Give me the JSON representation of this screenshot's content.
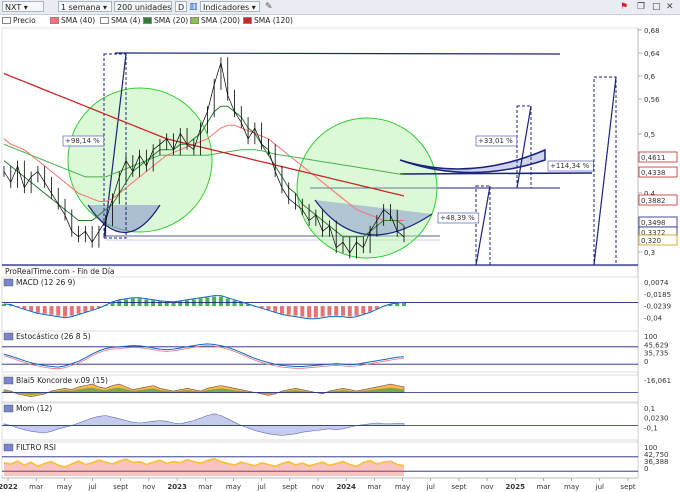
{
  "toolbar": {
    "symbol": "NXT",
    "period": "1 semana",
    "units": "200 unidades",
    "mode": "D",
    "indicators": "Indicadores"
  },
  "legend": [
    {
      "label": "Precio",
      "color": "#ffffff"
    },
    {
      "label": "SMA (40)",
      "color": "#ff6f6f"
    },
    {
      "label": "SMA (4)",
      "color": "#ffffff"
    },
    {
      "label": "SMA (20)",
      "color": "#2e7d32"
    },
    {
      "label": "SMA (200)",
      "color": "#8bc34a"
    },
    {
      "label": "SMA (120)",
      "color": "#c62828"
    }
  ],
  "source_label": "ProRealTime.com - Fin de Día",
  "x_labels": [
    "2022",
    "mar",
    "may",
    "jul",
    "sept",
    "nov",
    "2023",
    "mar",
    "may",
    "jul",
    "sept",
    "nov",
    "2024",
    "mar",
    "may",
    "jul",
    "sept",
    "nov",
    "2025",
    "mar",
    "may",
    "jul",
    "sept"
  ],
  "chart_data": [
    {
      "type": "line",
      "panel": "Precio",
      "ylim": [
        0.27,
        0.7
      ],
      "y_ticks": [
        "0,68",
        "0,64",
        "0,6",
        "0,56",
        "0,5",
        "0,4",
        "0,3"
      ],
      "price_tags": [
        {
          "text": "0,4611",
          "color": "#c62828"
        },
        {
          "text": "0,4338",
          "color": "#c62828"
        },
        {
          "text": "0,3882",
          "color": "#c62828"
        },
        {
          "text": "0,3498",
          "color": "#1a237e"
        },
        {
          "text": "0,3372",
          "color": "#1a237e"
        },
        {
          "text": "0,320",
          "color": "#d69a00"
        }
      ],
      "annotations": [
        "+98,14 %",
        "+33,01 %",
        "+114,34 %",
        "+48,39 %"
      ],
      "series": [
        {
          "name": "Precio",
          "values": [
            0.44,
            0.42,
            0.45,
            0.41,
            0.43,
            0.44,
            0.42,
            0.4,
            0.38,
            0.36,
            0.33,
            0.32,
            0.33,
            0.31,
            0.33,
            0.35,
            0.39,
            0.43,
            0.46,
            0.44,
            0.47,
            0.45,
            0.48,
            0.49,
            0.5,
            0.48,
            0.51,
            0.49,
            0.48,
            0.52,
            0.55,
            0.6,
            0.64,
            0.58,
            0.55,
            0.53,
            0.5,
            0.52,
            0.49,
            0.48,
            0.44,
            0.41,
            0.39,
            0.38,
            0.37,
            0.35,
            0.36,
            0.33,
            0.34,
            0.3,
            0.31,
            0.29,
            0.31,
            0.3,
            0.33,
            0.35,
            0.37,
            0.36,
            0.33,
            0.32
          ]
        },
        {
          "name": "SMA (40)",
          "values": [
            0.5,
            0.49,
            0.485,
            0.48,
            0.47,
            0.46,
            0.45,
            0.44,
            0.43,
            0.42,
            0.41,
            0.4,
            0.395,
            0.39,
            0.385,
            0.385,
            0.39,
            0.4,
            0.41,
            0.42,
            0.43,
            0.44,
            0.45,
            0.46,
            0.47,
            0.475,
            0.48,
            0.485,
            0.49,
            0.495,
            0.5,
            0.51,
            0.52,
            0.525,
            0.525,
            0.52,
            0.515,
            0.51,
            0.505,
            0.5,
            0.49,
            0.48,
            0.47,
            0.46,
            0.45,
            0.44,
            0.43,
            0.42,
            0.41,
            0.4,
            0.39,
            0.38,
            0.37,
            0.365,
            0.36,
            0.355,
            0.35,
            0.35,
            0.35,
            0.35
          ]
        },
        {
          "name": "SMA (20)",
          "values": [
            0.46,
            0.45,
            0.44,
            0.43,
            0.42,
            0.41,
            0.4,
            0.39,
            0.38,
            0.37,
            0.36,
            0.35,
            0.35,
            0.35,
            0.36,
            0.37,
            0.38,
            0.4,
            0.42,
            0.44,
            0.45,
            0.46,
            0.47,
            0.48,
            0.48,
            0.48,
            0.49,
            0.49,
            0.5,
            0.51,
            0.53,
            0.55,
            0.56,
            0.56,
            0.55,
            0.54,
            0.52,
            0.51,
            0.49,
            0.47,
            0.45,
            0.43,
            0.41,
            0.4,
            0.38,
            0.37,
            0.36,
            0.35,
            0.34,
            0.33,
            0.32,
            0.32,
            0.32,
            0.32,
            0.33,
            0.34,
            0.35,
            0.35,
            0.35,
            0.34
          ]
        },
        {
          "name": "SMA (200)",
          "values": [
            0.49,
            0.485,
            0.48,
            0.475,
            0.47,
            0.465,
            0.46,
            0.455,
            0.45,
            0.445,
            0.44,
            0.435,
            0.43,
            0.43,
            0.43,
            0.43,
            0.435,
            0.44,
            0.445,
            0.45,
            0.455,
            0.46,
            0.465,
            0.47,
            0.47,
            0.47,
            0.47,
            0.47,
            0.47,
            0.47,
            0.47,
            0.472,
            0.474,
            0.476,
            0.478,
            0.48,
            0.48,
            0.48,
            0.478,
            0.475,
            0.472,
            0.47,
            0.468,
            0.466,
            0.464,
            0.462,
            0.46,
            0.458,
            0.456,
            0.454,
            0.452,
            0.45,
            0.448,
            0.446,
            0.444,
            0.442,
            0.44,
            0.438,
            0.436,
            0.434
          ]
        },
        {
          "name": "SMA (120)",
          "values": [
            0.62,
            0.615,
            0.61,
            0.605,
            0.6,
            0.595,
            0.59,
            0.585,
            0.58,
            0.575,
            0.57,
            0.565,
            0.56,
            0.555,
            0.55,
            0.545,
            0.54,
            0.535,
            0.53,
            0.525,
            0.52,
            0.515,
            0.51,
            0.505,
            0.5,
            0.497,
            0.494,
            0.491,
            0.488,
            0.485,
            0.482,
            0.479,
            0.476,
            0.473,
            0.47,
            0.467,
            0.464,
            0.461,
            0.458,
            0.455,
            0.452,
            0.449,
            0.446,
            0.443,
            0.44,
            0.437,
            0.434,
            0.431,
            0.428,
            0.425,
            0.422,
            0.419,
            0.416,
            0.413,
            0.41,
            0.407,
            0.404,
            0.401,
            0.398,
            0.395
          ]
        }
      ]
    },
    {
      "type": "bar",
      "panel": "MACD (12 26 9)",
      "ylim": [
        -0.05,
        0.04
      ],
      "y_ticks": [
        "0,0074",
        "-0,0185",
        "-0,0239",
        "-0,04"
      ],
      "values": [
        0.004,
        0.003,
        -0.002,
        -0.006,
        -0.01,
        -0.014,
        -0.016,
        -0.018,
        -0.02,
        -0.022,
        -0.02,
        -0.016,
        -0.012,
        -0.008,
        -0.004,
        0.002,
        0.008,
        0.012,
        0.014,
        0.016,
        0.016,
        0.014,
        0.012,
        0.01,
        0.009,
        0.008,
        0.01,
        0.012,
        0.014,
        0.016,
        0.018,
        0.02,
        0.02,
        0.016,
        0.012,
        0.008,
        0.004,
        0.0,
        -0.004,
        -0.008,
        -0.012,
        -0.016,
        -0.018,
        -0.02,
        -0.022,
        -0.024,
        -0.024,
        -0.022,
        -0.02,
        -0.02,
        -0.02,
        -0.022,
        -0.02,
        -0.016,
        -0.012,
        -0.006,
        0.0,
        0.004,
        0.006,
        0.0074
      ]
    },
    {
      "type": "line",
      "panel": "Estocástico (26 8 5)",
      "ylim": [
        0,
        100
      ],
      "y_ticks": [
        "100",
        "45,629",
        "35,735",
        "0"
      ],
      "values": [
        55,
        48,
        40,
        32,
        25,
        20,
        15,
        12,
        10,
        14,
        22,
        30,
        42,
        55,
        66,
        74,
        78,
        80,
        82,
        84,
        83,
        80,
        76,
        72,
        70,
        72,
        76,
        80,
        84,
        88,
        90,
        88,
        84,
        78,
        70,
        60,
        50,
        40,
        32,
        26,
        20,
        16,
        14,
        12,
        12,
        14,
        16,
        18,
        20,
        22,
        20,
        18,
        20,
        24,
        28,
        32,
        36,
        40,
        44,
        45.6
      ]
    },
    {
      "type": "area",
      "panel": "Blai5 Koncorde v.09 (15)",
      "y_ticks": [
        "-16,061"
      ],
      "values": [
        2,
        1,
        -1,
        -2,
        -3,
        -2,
        -1,
        1,
        2,
        3,
        2,
        4,
        5,
        6,
        4,
        3,
        5,
        6,
        4,
        2,
        3,
        4,
        5,
        3,
        2,
        1,
        2,
        3,
        2,
        1,
        3,
        4,
        5,
        4,
        3,
        2,
        1,
        0,
        -1,
        -2,
        -1,
        1,
        2,
        3,
        2,
        1,
        0,
        -1,
        1,
        2,
        3,
        2,
        1,
        2,
        3,
        4,
        5,
        6,
        5,
        4
      ]
    },
    {
      "type": "area",
      "panel": "Mom (12)",
      "ylim": [
        -0.15,
        0.15
      ],
      "y_ticks": [
        "0,1",
        "0,0230",
        "-0,1"
      ],
      "values": [
        0.02,
        0.0,
        -0.03,
        -0.05,
        -0.07,
        -0.08,
        -0.09,
        -0.07,
        -0.04,
        -0.02,
        0.0,
        0.03,
        0.06,
        0.09,
        0.11,
        0.12,
        0.1,
        0.08,
        0.06,
        0.04,
        0.03,
        0.04,
        0.05,
        0.06,
        0.05,
        0.03,
        0.02,
        0.04,
        0.06,
        0.09,
        0.12,
        0.14,
        0.12,
        0.08,
        0.04,
        0.0,
        -0.03,
        -0.06,
        -0.08,
        -0.1,
        -0.11,
        -0.12,
        -0.11,
        -0.1,
        -0.08,
        -0.07,
        -0.06,
        -0.05,
        -0.04,
        -0.05,
        -0.04,
        -0.02,
        0.0,
        0.01,
        0.02,
        0.03,
        0.02,
        0.02,
        0.023,
        0.023
      ]
    },
    {
      "type": "line",
      "panel": "FILTRO RSI",
      "ylim": [
        0,
        100
      ],
      "y_ticks": [
        "100",
        "42,750",
        "36,388",
        "0"
      ],
      "values": [
        55,
        50,
        62,
        45,
        58,
        40,
        52,
        60,
        45,
        38,
        50,
        62,
        48,
        55,
        66,
        58,
        50,
        62,
        70,
        56,
        60,
        48,
        58,
        66,
        52,
        60,
        56,
        68,
        60,
        54,
        64,
        72,
        60,
        52,
        46,
        58,
        50,
        42,
        55,
        48,
        40,
        52,
        60,
        46,
        54,
        42,
        50,
        58,
        44,
        52,
        60,
        48,
        40,
        56,
        64,
        50,
        58,
        62,
        48,
        42.75
      ]
    }
  ]
}
